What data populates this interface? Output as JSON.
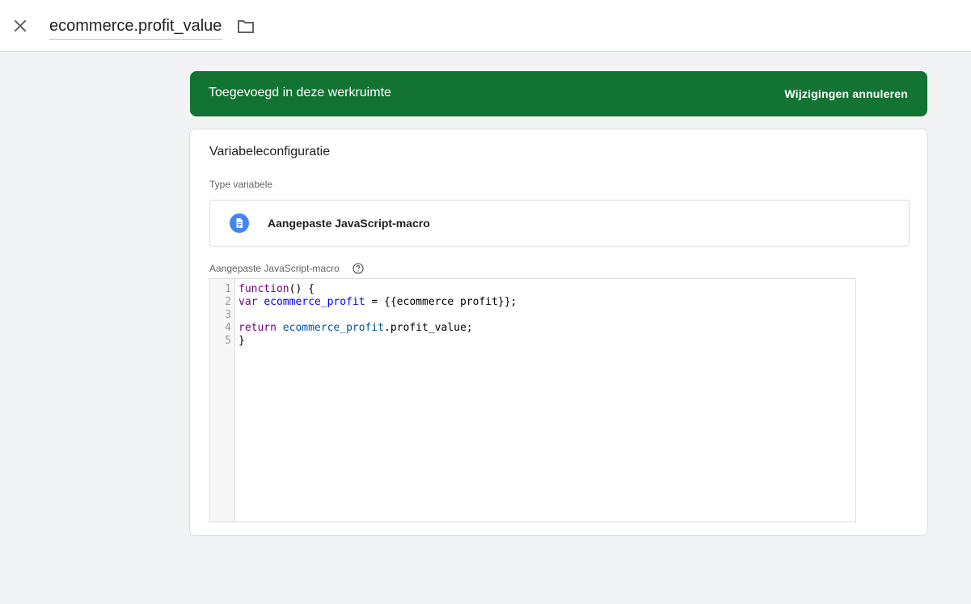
{
  "header": {
    "title": "ecommerce.profit_value",
    "close_icon": "close-icon",
    "folder_icon": "folder-icon"
  },
  "banner": {
    "text": "Toegevoegd in deze werkruimte",
    "action": "Wijzigingen annuleren",
    "color": "#137333"
  },
  "config": {
    "title": "Variabeleconfiguratie",
    "type_label": "Type variabele",
    "type_name": "Aangepaste JavaScript-macro",
    "type_icon": "document-icon",
    "type_icon_color": "#4285f4",
    "code_label": "Aangepaste JavaScript-macro",
    "help_icon": "help-icon"
  },
  "editor": {
    "line_numbers": [
      "1",
      "2",
      "3",
      "4",
      "5"
    ],
    "lines": [
      {
        "kw": "function",
        "rest": "() {"
      },
      {
        "kw": "var",
        "ident": "ecommerce_profit",
        "rest": " = {{ecommerce profit}};"
      },
      {
        "text": ""
      },
      {
        "kw": "return",
        "ident": "ecommerce_profit",
        "rest": ".profit_value;"
      },
      {
        "text": "}"
      }
    ]
  }
}
